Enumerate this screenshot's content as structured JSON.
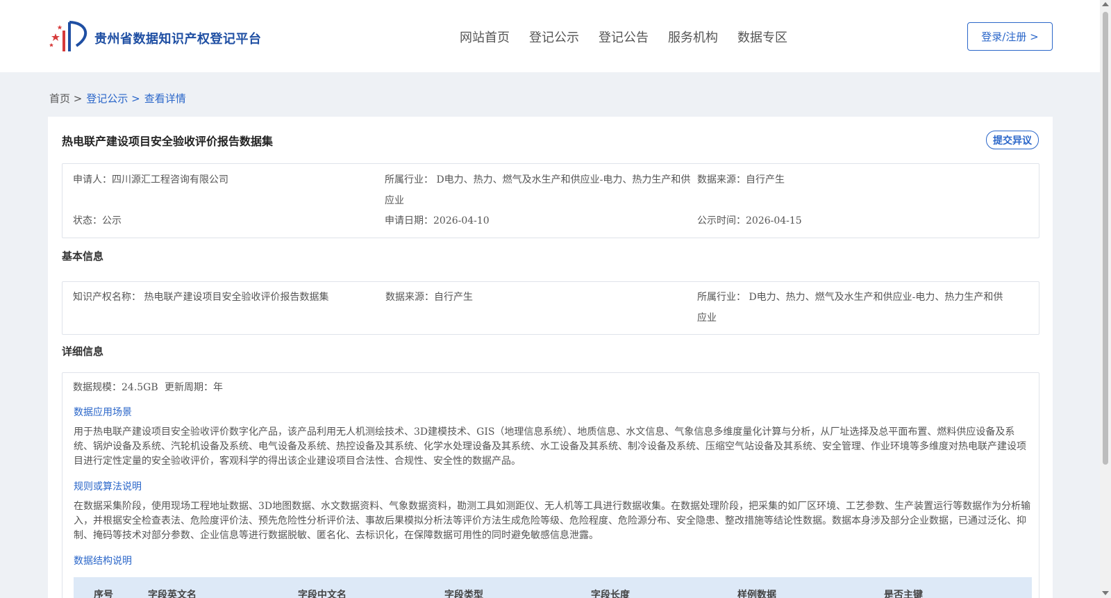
{
  "header": {
    "site_name": "贵州省数据知识产权登记平台",
    "nav": [
      "网站首页",
      "登记公示",
      "登记公告",
      "服务机构",
      "数据专区"
    ],
    "login_label": "登录/注册 >"
  },
  "breadcrumb": {
    "home": "首页 >",
    "level2": "登记公示 >",
    "current": "查看详情"
  },
  "detail": {
    "title": "热电联产建设项目安全验收评价报告数据集",
    "objection_label": "提交异议",
    "summary": {
      "applicant": "申请人：四川源汇工程咨询有限公司",
      "industry": "所属行业： D电力、热力、燃气及水生产和供应业-电力、热力生产和供应业",
      "source": "数据来源：自行产生",
      "status": "状态：公示",
      "apply_date": "申请日期：2026-04-10",
      "publicity_time": "公示时间：2026-04-15"
    },
    "basic_info": {
      "section_title": "基本信息",
      "ip_name": "知识产权名称： 热电联产建设项目安全验收评价报告数据集",
      "source": "数据来源：自行产生",
      "industry": "所属行业： D电力、热力、燃气及水生产和供应业-电力、热力生产和供应业"
    },
    "detail_info": {
      "section_title": "详细信息",
      "scale": "数据规模：24.5GB",
      "update_cycle": "更新周期：年",
      "scenario_title": "数据应用场景",
      "scenario_text": "用于热电联产建设项目安全验收评价数字化产品，该产品利用无人机测绘技术、3D建模技术、GIS（地理信息系统）、地质信息、水文信息、气象信息多维度量化计算与分析，从厂址选择及总平面布置、燃料供应设备及系统、锅炉设备及系统、汽轮机设备及系统、电气设备及系统、热控设备及其系统、化学水处理设备及其系统、水工设备及其系统、制冷设备及系统、压缩空气站设备及其系统、安全管理、作业环境等多维度对热电联产建设项目进行定性定量的安全验收评价，客观科学的得出该企业建设项目合法性、合规性、安全性的数据产品。",
      "algorithm_title": "规则或算法说明",
      "algorithm_text": "在数据采集阶段，使用现场工程地址数据、3D地图数据、水文数据资料、气象数据资料，勘测工具如测距仪、无人机等工具进行数据收集。在数据处理阶段，把采集的如厂区环境、工艺参数、生产装置运行等数据作为分析输入，并根据安全检查表法、危险度评价法、预先危险性分析评价法、事故后果模拟分析法等评价方法生成危险等级、危险程度、危险源分布、安全隐患、整改措施等结论性数据。数据本身涉及部分企业数据，已通过泛化、抑制、掩码等技术对部分参数、企业信息等进行数据脱敏、匿名化、去标识化，在保障数据可用性的同时避免敏感信息泄露。",
      "structure_title": "数据结构说明",
      "table_headers": [
        "序号",
        "字段英文名",
        "字段中文名",
        "字段类型",
        "字段长度",
        "样例数据",
        "是否主键"
      ]
    }
  },
  "colors": {
    "accent": "#2a66c9",
    "page_bg": "#eef1f5",
    "table_head_bg": "#dde9f7"
  }
}
